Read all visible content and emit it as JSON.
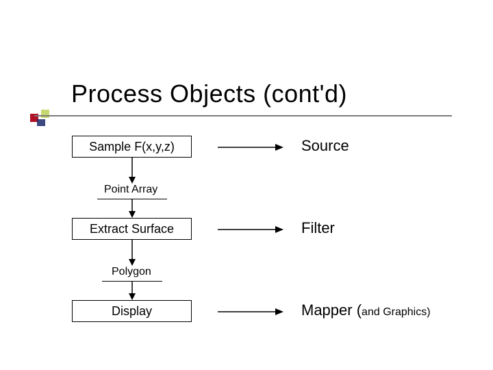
{
  "title": "Process Objects (cont'd)",
  "boxes": {
    "sample": "Sample F(x,y,z)",
    "extract": "Extract Surface",
    "display": "Display"
  },
  "intermediates": {
    "point_array": "Point Array",
    "polygon": "Polygon"
  },
  "labels": {
    "source": "Source",
    "filter": "Filter",
    "mapper": "Mapper (",
    "mapper_paren": "and Graphics)"
  }
}
